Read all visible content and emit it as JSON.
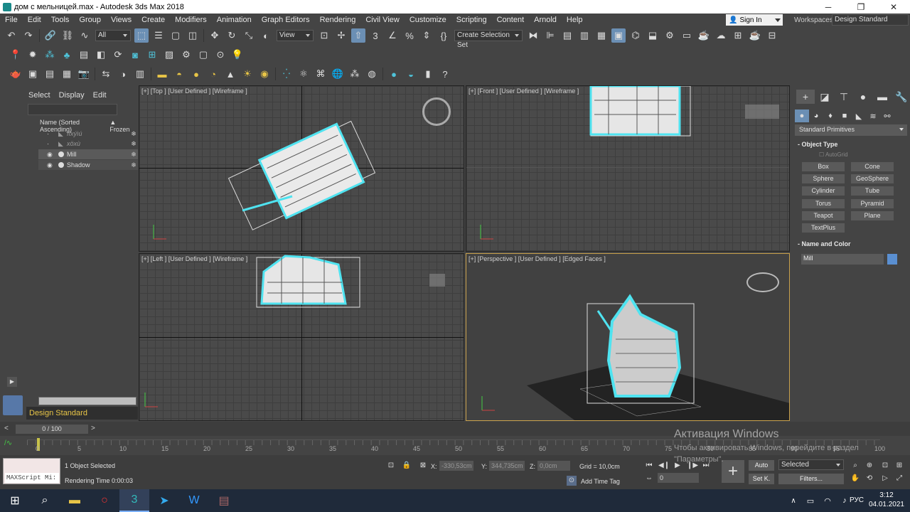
{
  "window": {
    "title": "дом с мельницей.max - Autodesk 3ds Max 2018",
    "minimize": "─",
    "maximize": "❐",
    "close": "✕"
  },
  "menu": [
    "File",
    "Edit",
    "Tools",
    "Group",
    "Views",
    "Create",
    "Modifiers",
    "Animation",
    "Graph Editors",
    "Rendering",
    "Civil View",
    "Customize",
    "Scripting",
    "Content",
    "Arnold",
    "Help"
  ],
  "account": {
    "signin": "Sign In",
    "workspaces_label": "Workspaces:",
    "workspace": "Design Standard"
  },
  "toolbar": {
    "filter": "All",
    "refcoord": "View",
    "selection_set": "Create Selection Set"
  },
  "scene": {
    "tabs": [
      "Select",
      "Display",
      "Edit"
    ],
    "col_name": "Name (Sorted Ascending)",
    "col_frozen": "▲ Frozen",
    "rows": [
      {
        "name": "ïîxýìú",
        "eye": "👁",
        "dim": true
      },
      {
        "name": "xöxù",
        "eye": "👁",
        "dim": true
      },
      {
        "name": "Mill",
        "eye": "👁",
        "sel": true
      },
      {
        "name": "Shadow",
        "eye": "👁"
      }
    ],
    "frozen_glyph": "❄",
    "layer": "Design Standard"
  },
  "viewports": {
    "top": "[+] [Top ] [User Defined ] [Wireframe ]",
    "front": "[+] [Front ] [User Defined ] [Wireframe ]",
    "left": "[+] [Left ] [User Defined ] [Wireframe ]",
    "persp": "[+] [Perspective ] [User Defined ] [Edged Faces ]"
  },
  "command_panel": {
    "dropdown": "Standard Primitives",
    "object_type": "Object Type",
    "autogrid": "AutoGrid",
    "primitives": [
      "Box",
      "Cone",
      "Sphere",
      "GeoSphere",
      "Cylinder",
      "Tube",
      "Torus",
      "Pyramid",
      "Teapot",
      "Plane",
      "TextPlus"
    ],
    "name_and_color": "Name and Color",
    "object_name": "Mill",
    "object_color": "#5a8fd1"
  },
  "timeline": {
    "frame_display": "0 / 100",
    "ticks": [
      "0",
      "5",
      "10",
      "15",
      "20",
      "25",
      "30",
      "35",
      "40",
      "45",
      "50",
      "55",
      "60",
      "65",
      "70",
      "75",
      "80",
      "85",
      "90",
      "95",
      "100"
    ]
  },
  "status": {
    "maxscript": "MAXScript Mi:",
    "selected": "1 Object Selected",
    "render_time": "Rendering Time  0:00:03",
    "x_label": "X:",
    "x": "-330,53cm",
    "y_label": "Y:",
    "y": "344,735cm",
    "z_label": "Z:",
    "z": "0,0cm",
    "grid": "Grid = 10,0cm",
    "add_time_tag": "Add Time Tag",
    "auto": "Auto",
    "setk": "Set K.",
    "selected_drop": "Selected",
    "filters": "Filters...",
    "frame": "0"
  },
  "watermark": {
    "line1": "Активация Windows",
    "line2": "Чтобы активировать Windows, перейдите в раздел",
    "line3": "\"Параметры\"."
  },
  "taskbar": {
    "lang": "РУС",
    "time": "3:12",
    "date": "04.01.2021"
  }
}
